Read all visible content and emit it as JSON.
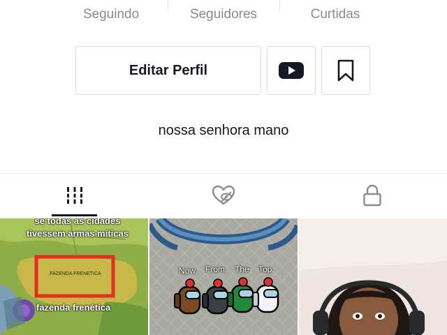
{
  "stats": {
    "following_label": "Seguindo",
    "followers_label": "Seguidores",
    "likes_label": "Curtidas"
  },
  "actions": {
    "edit_profile_label": "Editar Perfil",
    "youtube_icon": "youtube-icon",
    "bookmark_icon": "bookmark-icon"
  },
  "bio": "nossa senhora mano",
  "tabs": [
    {
      "name": "videos",
      "icon": "grid-icon",
      "active": true
    },
    {
      "name": "liked",
      "icon": "hidden-heart-icon",
      "active": false
    },
    {
      "name": "private",
      "icon": "lock-icon",
      "active": false
    }
  ],
  "videos": [
    {
      "caption_top": "se todas as cidades tivessem armas míticas",
      "map_label": "FAZENDA FRENETICA",
      "caption_bottom": "fazenda frenética"
    },
    {
      "names": [
        "Now",
        "From",
        "The",
        "Top"
      ]
    },
    {}
  ],
  "colors": {
    "text_primary": "#161823",
    "text_secondary": "#8a8b91",
    "border": "#dcdcdd",
    "youtube_red": "#161823"
  }
}
